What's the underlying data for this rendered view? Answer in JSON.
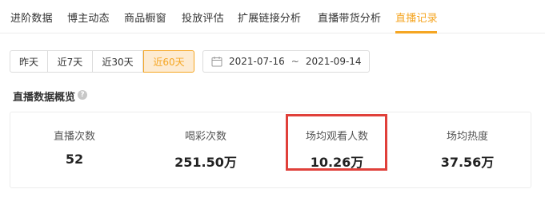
{
  "tabs": [
    {
      "label": "进阶数据",
      "active": false
    },
    {
      "label": "博主动态",
      "active": false
    },
    {
      "label": "商品橱窗",
      "active": false
    },
    {
      "label": "投放评估",
      "active": false
    },
    {
      "label": "扩展链接分析",
      "active": false
    },
    {
      "label": "直播带货分析",
      "active": false
    },
    {
      "label": "直播记录",
      "active": true
    }
  ],
  "date_filter": {
    "options": [
      "昨天",
      "近7天",
      "近30天",
      "近60天"
    ],
    "selected": "近60天"
  },
  "date_range": {
    "start": "2021-07-16",
    "separator": "~",
    "end": "2021-09-14",
    "icon": "calendar-icon"
  },
  "overview": {
    "title": "直播数据概览",
    "help_icon": "help-icon",
    "metrics": [
      {
        "label": "直播次数",
        "value": "52"
      },
      {
        "label": "喝彩次数",
        "value": "251.50万"
      },
      {
        "label": "场均观看人数",
        "value": "10.26万",
        "highlighted": true
      },
      {
        "label": "场均热度",
        "value": "37.56万"
      }
    ]
  },
  "colors": {
    "accent": "#f5a623",
    "accent_bg": "#fdebd2",
    "highlight_border": "#e0403a"
  }
}
